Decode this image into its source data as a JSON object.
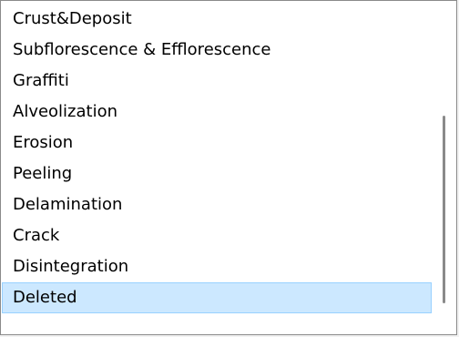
{
  "list": {
    "items": [
      {
        "label": "Crust&Deposit",
        "selected": false
      },
      {
        "label": "Subflorescence & Efflorescence",
        "selected": false
      },
      {
        "label": "Graffiti",
        "selected": false
      },
      {
        "label": "Alveolization",
        "selected": false
      },
      {
        "label": "Erosion",
        "selected": false
      },
      {
        "label": "Peeling",
        "selected": false
      },
      {
        "label": "Delamination",
        "selected": false
      },
      {
        "label": "Crack",
        "selected": false
      },
      {
        "label": "Disintegration",
        "selected": false
      },
      {
        "label": "Deleted",
        "selected": true
      }
    ]
  },
  "colors": {
    "selection_background": "#cce8ff",
    "selection_border": "#99d1ff",
    "scroll_thumb": "#8a8a8a"
  }
}
